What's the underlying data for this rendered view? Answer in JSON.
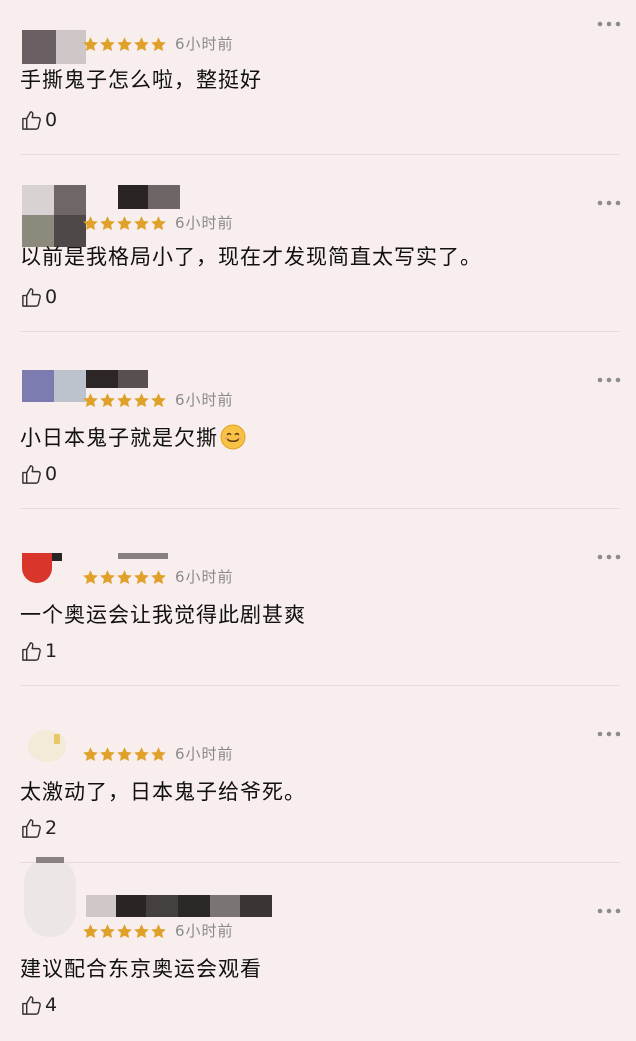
{
  "colors": {
    "background": "#f8eeee",
    "star": "#e0a12a",
    "meta_text": "#8a8a8a",
    "divider": "#e6dada"
  },
  "icons": {
    "more": "more-dots-icon",
    "like": "thumbs-up-icon",
    "rating": "star-icon"
  },
  "comments": [
    {
      "stars": 5,
      "time": "6小时前",
      "text": "手撕鬼子怎么啦，整挺好",
      "emoji": "",
      "likes": "0"
    },
    {
      "stars": 5,
      "time": "6小时前",
      "text": "以前是我格局小了，现在才发现简直太写实了。",
      "emoji": "",
      "likes": "0"
    },
    {
      "stars": 5,
      "time": "6小时前",
      "text": "小日本鬼子就是欠撕",
      "emoji": "smiling-face-emoji",
      "likes": "0"
    },
    {
      "stars": 5,
      "time": "6小时前",
      "text": "一个奥运会让我觉得此剧甚爽",
      "emoji": "",
      "likes": "1"
    },
    {
      "stars": 5,
      "time": "6小时前",
      "text": "太激动了，日本鬼子给爷死。",
      "emoji": "",
      "likes": "2"
    },
    {
      "stars": 5,
      "time": "6小时前",
      "text": "建议配合东京奥运会观看",
      "emoji": "",
      "likes": "4"
    }
  ]
}
